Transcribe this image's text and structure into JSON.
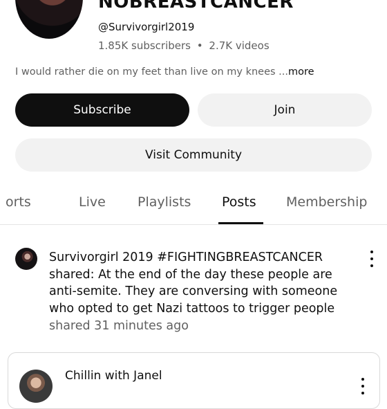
{
  "channel": {
    "title": "NOBREASTCANCER",
    "handle": "@Survivorgirl2019",
    "subscribers": "1.85K subscribers",
    "separator": "•",
    "videos": "2.7K videos",
    "description": "I would rather die on my feet than live on my knees ...",
    "more_label": "more"
  },
  "buttons": {
    "subscribe": "Subscribe",
    "join": "Join",
    "visit_community": "Visit Community"
  },
  "tabs": [
    {
      "label": "orts"
    },
    {
      "label": "Live"
    },
    {
      "label": "Playlists"
    },
    {
      "label": "Posts",
      "active": true
    },
    {
      "label": "Membership"
    }
  ],
  "post": {
    "text": "Survivorgirl 2019 #FIGHTINGBREASTCANCER shared: At the end of the day these people are anti-semite. They are conversing with someone who opted to get Nazi tattoos to trigger people",
    "time": "shared 31 minutes ago"
  },
  "shared_card": {
    "author": "Chillin with Janel"
  },
  "icons": {
    "post_menu": "more-vert-icon",
    "card_menu": "more-vert-icon"
  }
}
